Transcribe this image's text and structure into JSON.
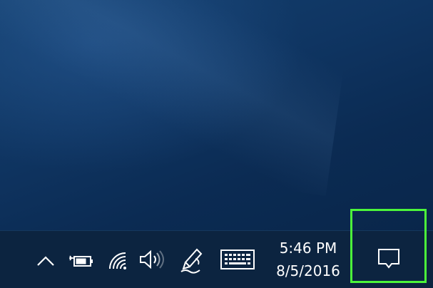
{
  "taskbar": {
    "tray": {
      "chevron_icon": "chevron-up-icon",
      "battery_icon": "battery-icon",
      "network_icon": "wifi-icon",
      "volume_icon": "speaker-icon",
      "pen_icon": "windows-ink-pen-icon",
      "keyboard_icon": "touch-keyboard-icon"
    },
    "clock": {
      "time": "5:46 PM",
      "date": "8/5/2016"
    },
    "action_center": {
      "icon": "notification-speech-bubble-icon",
      "highlight_color": "#4cf53a"
    }
  },
  "colors": {
    "desktop_bg": "#0f3562",
    "taskbar_bg": "#0c2440",
    "icon_color": "#ffffff"
  }
}
